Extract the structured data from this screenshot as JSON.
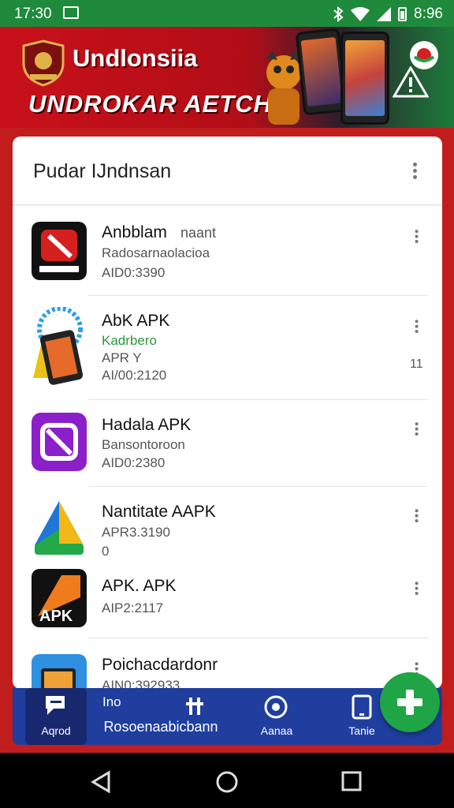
{
  "status_bar": {
    "time": "17:30",
    "right_time": "8:96",
    "icons": [
      "image-icon",
      "bluetooth-icon",
      "wifi-icon",
      "signal-icon",
      "battery-icon"
    ]
  },
  "banner": {
    "title": "Undlonsiia",
    "subtitle": "UNDROKAR AETCH"
  },
  "card": {
    "title": "Pudar IJndnsan",
    "apps": [
      {
        "name": "Anbblam",
        "name_suffix": "naant",
        "line1": "Radosarnaolacioa",
        "line2": "AID0:3390",
        "extra": ""
      },
      {
        "name": "AbK APK",
        "line1": "Kadrbero",
        "line2": "APR Y",
        "line3": "AI/00:2120",
        "extra": "11"
      },
      {
        "name": "Hadala APK",
        "line1": "Bansontoroon",
        "line2": "AID0:2380"
      },
      {
        "name": "Nantitate AAPK",
        "line1": "APR3.3190",
        "line2": "0"
      },
      {
        "name": "APK. APK",
        "line1": "AIP2:2117"
      },
      {
        "name": "Poichacdardonr",
        "line1": "AIN0:392933"
      }
    ]
  },
  "bottom_nav": {
    "items": [
      {
        "label": "Aqrod",
        "icon": "chat-icon"
      },
      {
        "label": "Rosoenaabicbann",
        "icon": "tune-icon",
        "overlay": "Ino"
      },
      {
        "label": "Aanaa",
        "icon": "target-icon"
      },
      {
        "label": "Tanie",
        "icon": "tablet-icon"
      }
    ]
  },
  "fab": {
    "icon": "plus-icon"
  },
  "system_nav": {
    "icons": [
      "back-icon",
      "home-icon",
      "recents-icon"
    ]
  },
  "colors": {
    "status_bar": "#1f8a3c",
    "banner_red": "#c8101a",
    "nav_blue": "#1f3e9e",
    "fab_green": "#1fa446",
    "frame_red": "#c21d1d"
  }
}
